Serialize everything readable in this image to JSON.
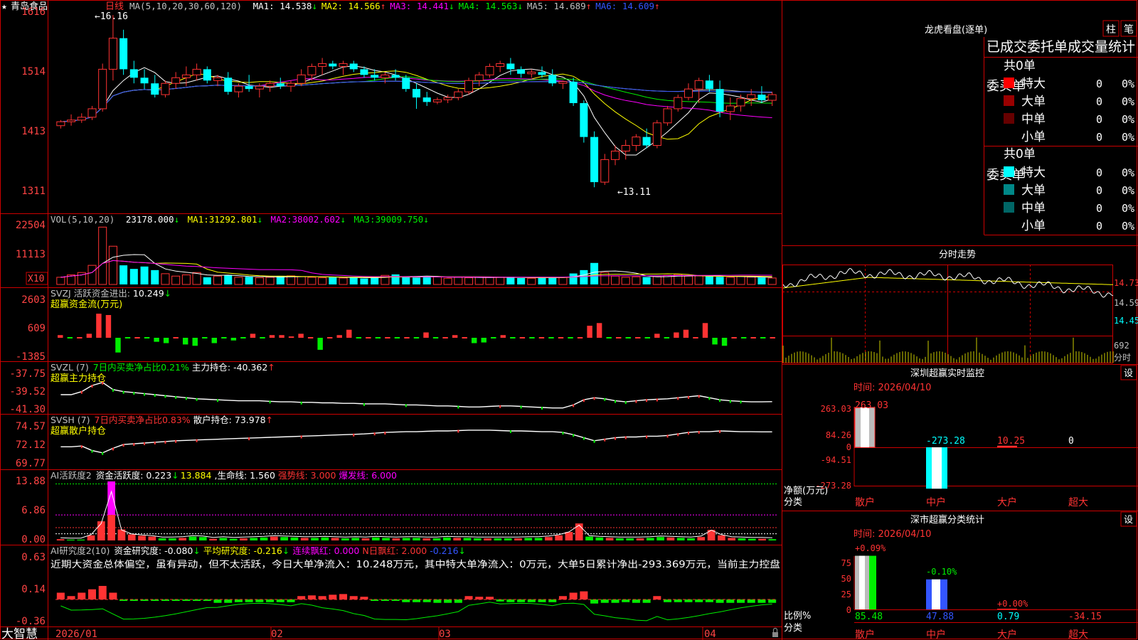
{
  "colors": {
    "up": "#ff3333",
    "down": "#00ffff",
    "frame": "#cc0000",
    "axis_text": "#ff4444",
    "white": "#ffffff",
    "yellow": "#ffff00",
    "magenta": "#ff00ff",
    "green": "#00ee00",
    "blue": "#3355ff",
    "gray": "#c0c0c0"
  },
  "header": {
    "star": "★",
    "stock_name": "青岛食品",
    "period": "日线",
    "ma_label": "MA(5,10,20,30,60,120)",
    "ma_items": [
      {
        "label": "MA1:",
        "value": "14.538",
        "arrow": "↓",
        "color": "#ffffff"
      },
      {
        "label": "MA2:",
        "value": "14.566",
        "arrow": "↑",
        "color": "#ffff00"
      },
      {
        "label": "MA3:",
        "value": "14.441",
        "arrow": "↓",
        "color": "#ff00ff"
      },
      {
        "label": "MA4:",
        "value": "14.563",
        "arrow": "↓",
        "color": "#00ee00"
      },
      {
        "label": "MA5:",
        "value": "14.689",
        "arrow": "↑",
        "color": "#c0c0c0"
      },
      {
        "label": "MA6:",
        "value": "14.609",
        "arrow": "↑",
        "color": "#3355ff"
      }
    ]
  },
  "price_axis": [
    "1616",
    "1514",
    "1413",
    "1311"
  ],
  "price_annotations": {
    "high": "16.16",
    "low": "13.11"
  },
  "vol_header": {
    "label": "VOL(5,10,20)",
    "value": "23178.000",
    "arrow": "↓",
    "ma1_label": "MA1:",
    "ma1": "31292.801",
    "ma1_arrow": "↓",
    "ma2_label": "MA2:",
    "ma2": "38002.602",
    "ma2_arrow": "↓",
    "ma3_label": "MA3:",
    "ma3": "39009.750",
    "ma3_arrow": "↓"
  },
  "vol_axis": [
    "22504",
    "11113",
    "X10"
  ],
  "svzj": {
    "line1_label": "SVZJ  活跃资金进出:",
    "line1_value": "10.249",
    "line1_arrow": "↓",
    "line2": "超赢资金流(万元)",
    "axis": [
      "2603",
      "609",
      "-1385"
    ]
  },
  "svzl": {
    "prefix": "SVZL (7)",
    "green_text": "7日内买卖净占比0.21%",
    "label": "主力持仓:",
    "value": "-40.362",
    "arrow": "↑",
    "line2": "超赢主力持仓",
    "axis": [
      "-37.75",
      "-39.52",
      "-41.30"
    ]
  },
  "svsh": {
    "prefix": "SVSH (7)",
    "red_text": "7日内买卖净占比0.83%",
    "label": "散户持仓:",
    "value": "73.978",
    "arrow": "↑",
    "line2": "超赢散户持仓",
    "axis": [
      "74.57",
      "72.12",
      "69.77"
    ]
  },
  "ai_activity": {
    "prefix": "AI活跃度2",
    "label1": "资金活跃度:",
    "v1": "0.223",
    "a1": "↓",
    "v2": "13.884",
    "label3": "生命线:",
    "v3": "1.560",
    "label4": "强势线:",
    "v4": "3.000",
    "label5": "爆发线:",
    "v5": "6.000",
    "axis": [
      "13.88",
      "6.86",
      "0.00"
    ]
  },
  "ai_research": {
    "prefix": "AI研究度2(10)",
    "label1": "资金研究度:",
    "v1": "-0.080",
    "a1": "↓",
    "label2": "平均研究度:",
    "v2": "-0.216",
    "a2": "↓",
    "label3": "连续飘红:",
    "v3": "0.000",
    "label4": "N日飘红:",
    "v4": "2.000",
    "v5": "-0.216",
    "a5": "↓",
    "comment": "近期大资金总体偏空，虽有异动，但不太活跃，今日大单净流入：10.248万元，其中特大单净流入：0万元，大单5日累计净出-293.369万元，当前主力控盘",
    "axis": [
      "0.63",
      "0.14",
      "-0.36"
    ]
  },
  "date_axis": [
    "2026/01",
    "02",
    "03",
    "04"
  ],
  "brand": "大智慧",
  "right": {
    "dragon_title": "龙虎看盘(逐单)",
    "btn_zhu": "柱",
    "btn_bi": "笔",
    "stats_title": "已成交委托单成交量统计",
    "buy_side_label": "委买单",
    "sell_side_label": "委卖单",
    "buy_total": "共0单",
    "sell_total": "共0单",
    "buy_rows": [
      {
        "name": "特大",
        "count": "0",
        "pct": "0%",
        "color": "#ff0000"
      },
      {
        "name": "大单",
        "count": "0",
        "pct": "0%",
        "color": "#990000"
      },
      {
        "name": "中单",
        "count": "0",
        "pct": "0%",
        "color": "#660000"
      },
      {
        "name": "小单",
        "count": "0",
        "pct": "0%",
        "color": ""
      }
    ],
    "sell_rows": [
      {
        "name": "特大",
        "count": "0",
        "pct": "0%",
        "color": "#00ffff"
      },
      {
        "name": "大单",
        "count": "0",
        "pct": "0%",
        "color": "#008888"
      },
      {
        "name": "中单",
        "count": "0",
        "pct": "0%",
        "color": "#006666"
      },
      {
        "name": "小单",
        "count": "0",
        "pct": "0%",
        "color": ""
      }
    ],
    "intraday_title": "分时走势",
    "intraday_prices": [
      "14.73",
      "14.59",
      "14.45"
    ],
    "intraday_vol": "692",
    "intraday_label": "分时",
    "monitor_title": "深圳超赢实时监控",
    "monitor_btn": "设",
    "monitor_time": "时间: 2026/04/10",
    "monitor_axis": [
      "263.03",
      "84.26",
      "0",
      "-94.51",
      "-273.28"
    ],
    "monitor_values": [
      "263.03",
      "-273.28",
      "10.25",
      "0"
    ],
    "monitor_ylabel1": "净额(万元)",
    "monitor_ylabel2": "分类",
    "categories": [
      "散户",
      "中户",
      "大户",
      "超大"
    ],
    "class_title": "深市超赢分类统计",
    "class_btn": "设",
    "class_time": "时间: 2026/04/10",
    "class_axis": [
      "75",
      "50",
      "25",
      "0"
    ],
    "class_top_labels": [
      "+0.09%",
      "-0.10%",
      "+0.00%"
    ],
    "class_bottom_values": [
      "85.48",
      "47.88",
      "0.79",
      "-34.15"
    ],
    "class_ylabel1": "比例%",
    "class_ylabel2": "分类"
  },
  "chart_data": [
    {
      "type": "candlestick",
      "title": "青岛食品 日线",
      "ylim": [
        13.0,
        16.2
      ],
      "ohlc": [
        [
          14.2,
          14.3,
          14.15,
          14.27
        ],
        [
          14.27,
          14.4,
          14.2,
          14.3
        ],
        [
          14.3,
          14.42,
          14.25,
          14.35
        ],
        [
          14.35,
          14.55,
          14.3,
          14.5
        ],
        [
          14.5,
          15.3,
          14.45,
          15.2
        ],
        [
          15.2,
          16.16,
          15.0,
          15.75
        ],
        [
          15.75,
          15.9,
          15.1,
          15.2
        ],
        [
          15.2,
          15.35,
          14.95,
          15.05
        ],
        [
          15.05,
          15.2,
          14.85,
          14.95
        ],
        [
          14.95,
          15.1,
          14.7,
          14.75
        ],
        [
          14.75,
          15.0,
          14.7,
          14.95
        ],
        [
          14.95,
          15.15,
          14.85,
          15.05
        ],
        [
          15.05,
          15.25,
          14.9,
          15.1
        ],
        [
          15.1,
          15.3,
          15.0,
          15.2
        ],
        [
          15.2,
          15.25,
          14.95,
          15.0
        ],
        [
          15.0,
          15.1,
          14.9,
          15.05
        ],
        [
          15.05,
          15.15,
          14.75,
          14.8
        ],
        [
          14.8,
          14.95,
          14.7,
          14.9
        ],
        [
          14.9,
          15.1,
          14.8,
          14.85
        ],
        [
          14.85,
          14.95,
          14.7,
          14.9
        ],
        [
          14.9,
          15.0,
          14.8,
          14.95
        ],
        [
          14.95,
          15.05,
          14.85,
          14.9
        ],
        [
          14.9,
          15.0,
          14.8,
          14.95
        ],
        [
          14.95,
          15.2,
          14.9,
          15.1
        ],
        [
          15.1,
          15.3,
          15.0,
          15.25
        ],
        [
          15.25,
          15.4,
          15.1,
          15.3
        ],
        [
          15.3,
          15.35,
          15.2,
          15.25
        ],
        [
          15.25,
          15.35,
          15.1,
          15.3
        ],
        [
          15.3,
          15.35,
          15.15,
          15.2
        ],
        [
          15.2,
          15.25,
          15.05,
          15.1
        ],
        [
          15.1,
          15.2,
          15.0,
          15.05
        ],
        [
          15.05,
          15.15,
          14.95,
          15.1
        ],
        [
          15.1,
          15.2,
          15.0,
          15.05
        ],
        [
          15.05,
          15.1,
          14.8,
          14.85
        ],
        [
          14.85,
          14.95,
          14.5,
          14.7
        ],
        [
          14.7,
          14.8,
          14.55,
          14.62
        ],
        [
          14.62,
          14.7,
          14.58,
          14.66
        ],
        [
          14.66,
          14.75,
          14.6,
          14.7
        ],
        [
          14.7,
          14.85,
          14.65,
          14.8
        ],
        [
          14.8,
          15.05,
          14.75,
          15.0
        ],
        [
          15.0,
          15.15,
          14.9,
          15.1
        ],
        [
          15.1,
          15.3,
          15.05,
          15.25
        ],
        [
          15.25,
          15.35,
          15.15,
          15.3
        ],
        [
          15.3,
          15.4,
          15.1,
          15.2
        ],
        [
          15.2,
          15.25,
          15.05,
          15.12
        ],
        [
          15.12,
          15.2,
          15.05,
          15.15
        ],
        [
          15.15,
          15.25,
          15.05,
          15.1
        ],
        [
          15.1,
          15.2,
          14.9,
          14.95
        ],
        [
          14.95,
          15.0,
          14.85,
          14.98
        ],
        [
          14.98,
          15.05,
          14.55,
          14.6
        ],
        [
          14.6,
          14.65,
          13.9,
          14.0
        ],
        [
          14.0,
          14.1,
          13.11,
          13.2
        ],
        [
          13.2,
          13.7,
          13.15,
          13.6
        ],
        [
          13.6,
          13.85,
          13.5,
          13.75
        ],
        [
          13.75,
          13.95,
          13.6,
          13.85
        ],
        [
          13.85,
          14.05,
          13.75,
          14.0
        ],
        [
          14.0,
          14.15,
          13.8,
          13.85
        ],
        [
          13.85,
          14.3,
          13.8,
          14.25
        ],
        [
          14.25,
          14.55,
          14.2,
          14.5
        ],
        [
          14.5,
          14.75,
          14.45,
          14.7
        ],
        [
          14.7,
          14.95,
          14.65,
          14.85
        ],
        [
          14.85,
          15.05,
          14.6,
          15.0
        ],
        [
          15.0,
          15.1,
          14.8,
          14.85
        ],
        [
          14.85,
          15.0,
          14.35,
          14.45
        ],
        [
          14.45,
          14.7,
          14.3,
          14.55
        ],
        [
          14.55,
          14.75,
          14.45,
          14.68
        ],
        [
          14.68,
          14.85,
          14.55,
          14.75
        ],
        [
          14.75,
          14.9,
          14.6,
          14.65
        ],
        [
          14.65,
          14.8,
          14.55,
          14.75
        ]
      ]
    },
    {
      "type": "bar",
      "title": "VOL(5,10,20)",
      "ylim": [
        0,
        25000
      ],
      "values": [
        3000,
        4000,
        5000,
        8000,
        24000,
        16000,
        8000,
        6500,
        7500,
        6000,
        4500,
        3500,
        4000,
        5000,
        3000,
        3500,
        4000,
        3000,
        3200,
        2800,
        3000,
        3500,
        3600,
        3300,
        3000,
        2800,
        3100,
        2700,
        3000,
        2500,
        2800,
        3800,
        4200,
        3100,
        2900,
        3500,
        3300,
        2600,
        3000,
        2800,
        3000,
        3100,
        3000,
        2900,
        2700,
        2600,
        3000,
        3100,
        2900,
        4600,
        6000,
        9000,
        5000,
        3500,
        3000,
        3200,
        3100,
        3300,
        3800,
        4200,
        3500,
        3600,
        3400,
        3200,
        3000,
        3300,
        3100,
        2900,
        2700
      ]
    },
    {
      "type": "bar",
      "title": "SVZJ 超赢资金流(万元)",
      "ylim": [
        -1385,
        2603
      ],
      "values": [
        200,
        0,
        0,
        300,
        1800,
        1700,
        -1100,
        0,
        0,
        0,
        -300,
        -400,
        0,
        -500,
        -600,
        0,
        -400,
        0,
        -200,
        0,
        300,
        0,
        200,
        200,
        100,
        300,
        0,
        -900,
        0,
        200,
        600,
        0,
        0,
        0,
        0,
        0,
        0,
        0,
        400,
        0,
        0,
        200,
        0,
        -400,
        -350,
        0,
        200,
        0,
        0,
        0,
        0,
        0,
        0,
        0,
        0,
        900,
        1100,
        0,
        0,
        0,
        0,
        0,
        300,
        0,
        400,
        600,
        0,
        1100,
        -500,
        -600,
        0,
        0,
        0,
        0,
        0
      ]
    },
    {
      "type": "line",
      "title": "SVZL 超赢主力持仓",
      "ylim": [
        -41.3,
        -37.75
      ],
      "values": [
        -39.7,
        -39.7,
        -39.4,
        -38.8,
        -38.5,
        -39.2,
        -39.4,
        -39.5,
        -39.6,
        -39.7,
        -39.8,
        -39.9,
        -40.0,
        -40.1,
        -40.15,
        -40.2,
        -40.25,
        -40.3,
        -40.3,
        -40.3,
        -40.35,
        -40.4,
        -40.4,
        -40.45,
        -40.45,
        -40.5,
        -40.5,
        -40.55,
        -40.55,
        -40.6,
        -40.6,
        -40.6,
        -40.65,
        -40.7,
        -40.7,
        -40.75,
        -40.8,
        -40.8,
        -40.85,
        -40.9,
        -40.9,
        -40.85,
        -40.8,
        -40.8,
        -40.85,
        -40.9,
        -40.95,
        -41.0,
        -41.0,
        -40.7,
        -40.2,
        -40.0,
        -40.1,
        -40.3,
        -40.4,
        -40.3,
        -40.2,
        -40.15,
        -40.1,
        -40.0,
        -39.9,
        -39.8,
        -40.0,
        -40.2,
        -40.3,
        -40.35,
        -40.4,
        -40.4,
        -40.38
      ]
    },
    {
      "type": "line",
      "title": "SVSH 超赢散户持仓",
      "ylim": [
        69.77,
        74.57
      ],
      "values": [
        72.0,
        72.0,
        72.1,
        71.5,
        71.2,
        71.8,
        72.3,
        72.4,
        72.5,
        72.6,
        72.7,
        72.8,
        72.85,
        72.9,
        72.95,
        73.0,
        73.05,
        73.1,
        73.15,
        73.2,
        73.25,
        73.3,
        73.35,
        73.4,
        73.45,
        73.5,
        73.55,
        73.6,
        73.65,
        73.7,
        73.8,
        73.9,
        73.95,
        74.0,
        74.0,
        74.05,
        74.1,
        74.1,
        74.15,
        74.2,
        74.2,
        74.2,
        74.15,
        74.1,
        74.1,
        74.05,
        74.0,
        74.0,
        73.9,
        73.6,
        73.2,
        72.8,
        73.0,
        73.2,
        73.3,
        73.3,
        73.4,
        73.4,
        73.5,
        73.7,
        73.9,
        74.0,
        74.0,
        74.1,
        74.05,
        74.0,
        74.0,
        73.98,
        73.98
      ]
    },
    {
      "type": "bar",
      "title": "AI活跃度2",
      "ylim": [
        0,
        13.88
      ],
      "values": [
        0.3,
        0.2,
        0.2,
        1.2,
        4.5,
        13.88,
        2.6,
        1.4,
        1.1,
        0.9,
        0.5,
        0.5,
        0.6,
        0.9,
        0.8,
        0.4,
        0.6,
        0.4,
        0.5,
        0.6,
        0.7,
        0.9,
        0.8,
        0.7,
        0.6,
        0.6,
        0.7,
        0.6,
        0.5,
        0.6,
        0.5,
        0.7,
        0.6,
        0.5,
        0.6,
        0.6,
        0.5,
        0.5,
        0.7,
        0.6,
        0.6,
        0.5,
        0.5,
        0.5,
        0.5,
        0.5,
        0.6,
        0.6,
        0.8,
        1.2,
        2.0,
        4.0,
        0.9,
        0.7,
        0.6,
        0.5,
        0.5,
        0.5,
        0.6,
        0.8,
        0.7,
        0.6,
        0.5,
        0.8,
        2.5,
        1.2,
        0.6,
        0.5,
        0.4,
        0.4,
        0.3
      ]
    },
    {
      "type": "bar",
      "title": "AI研究度2(10)",
      "ylim": [
        -0.36,
        0.63
      ],
      "values": [
        0.1,
        0.05,
        0.1,
        0.15,
        0.2,
        0.1,
        -0.01,
        -0.01,
        -0.01,
        -0.01,
        -0.01,
        -0.01,
        -0.01,
        -0.01,
        -0.01,
        -0.05,
        -0.05,
        -0.04,
        -0.04,
        -0.04,
        -0.04,
        -0.04,
        -0.04,
        0.05,
        0.06,
        0.05,
        0.07,
        0.08,
        0.05,
        0.04,
        -0.02,
        -0.02,
        -0.02,
        -0.04,
        -0.04,
        -0.04,
        -0.05,
        -0.05,
        -0.05,
        0.05,
        0.04,
        0.04,
        -0.03,
        -0.04,
        -0.04,
        -0.04,
        -0.04,
        -0.04,
        0.05,
        0.1,
        0.12,
        -0.06,
        -0.05,
        -0.05,
        -0.04,
        -0.05,
        -0.05,
        0.05,
        -0.04,
        -0.04,
        -0.04,
        -0.04,
        -0.04,
        -0.05,
        -0.05,
        -0.05,
        -0.05,
        -0.05,
        -0.05
      ]
    },
    {
      "type": "bar",
      "title": "深圳超赢实时监控",
      "categories": [
        "散户",
        "中户",
        "大户",
        "超大"
      ],
      "values": [
        263.03,
        -273.28,
        10.25,
        0
      ],
      "ylim": [
        -273.28,
        263.03
      ]
    },
    {
      "type": "bar",
      "title": "深市超赢分类统计",
      "categories": [
        "散户",
        "中户",
        "大户",
        "超大"
      ],
      "values": [
        85.48,
        47.88,
        0.79,
        -34.15
      ],
      "ylim": [
        0,
        85
      ]
    }
  ]
}
